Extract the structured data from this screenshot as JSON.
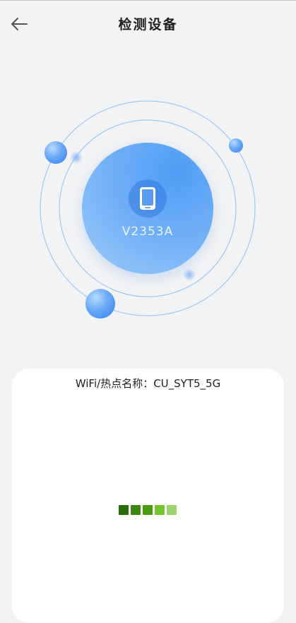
{
  "header": {
    "title": "检测设备",
    "back_icon": "arrow-left-icon"
  },
  "device": {
    "name": "V2353A",
    "icon": "phone-icon"
  },
  "card": {
    "wifi_label": "WiFi/热点名称：CU_SYT5_5G"
  },
  "colors": {
    "accent": "#5aa5f7",
    "orbit_line": "#8ec0f6",
    "loader": [
      "#2a6b0c",
      "#3a860f",
      "#4a9a12",
      "#75c42d",
      "#9ed36b"
    ]
  }
}
